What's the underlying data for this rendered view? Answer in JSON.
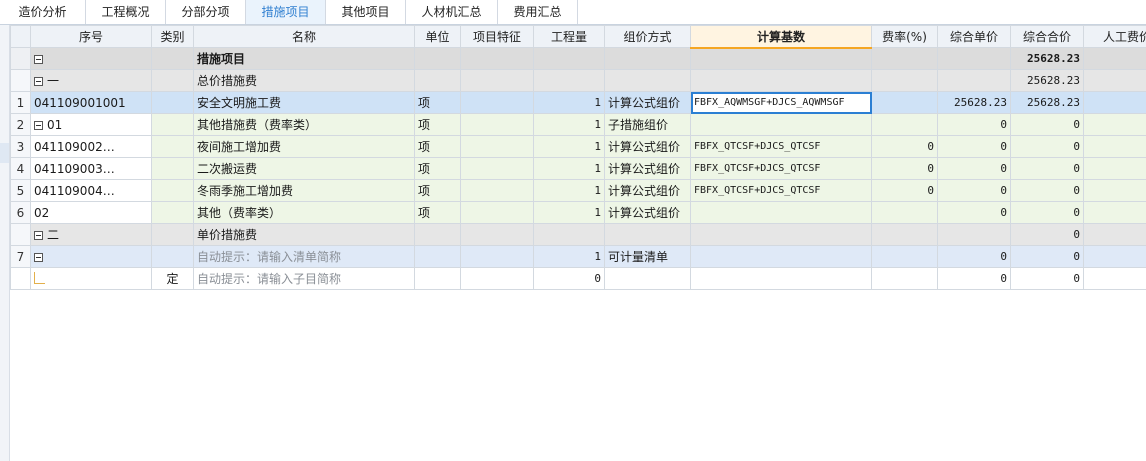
{
  "tabs": [
    "造价分析",
    "工程概况",
    "分部分项",
    "措施项目",
    "其他项目",
    "人材机汇总",
    "费用汇总"
  ],
  "active_tab": "措施项目",
  "columns": [
    "序号",
    "类别",
    "名称",
    "单位",
    "项目特征",
    "工程量",
    "组价方式",
    "计算基数",
    "费率(%)",
    "综合单价",
    "综合合价",
    "人工费价"
  ],
  "rows": [
    {
      "rn": "",
      "seq": "",
      "cat": "",
      "name": "措施项目",
      "unit": "",
      "feat": "",
      "qty": "",
      "method": "",
      "base": "",
      "rate": "",
      "uprice": "",
      "total": "25628.23"
    },
    {
      "rn": "",
      "seq": "一",
      "cat": "",
      "name": "总价措施费",
      "unit": "",
      "feat": "",
      "qty": "",
      "method": "",
      "base": "",
      "rate": "",
      "uprice": "",
      "total": "25628.23"
    },
    {
      "rn": "1",
      "seq": "041109001001",
      "cat": "",
      "name": "安全文明施工费",
      "unit": "项",
      "feat": "",
      "qty": "1",
      "method": "计算公式组价",
      "base": "FBFX_AQWMSGF+DJCS_AQWMSGF",
      "rate": "",
      "uprice": "25628.23",
      "total": "25628.23"
    },
    {
      "rn": "2",
      "seq": "01",
      "cat": "",
      "name": "其他措施费（费率类）",
      "unit": "项",
      "feat": "",
      "qty": "1",
      "method": "子措施组价",
      "base": "",
      "rate": "",
      "uprice": "0",
      "total": "0"
    },
    {
      "rn": "3",
      "seq": "041109002…",
      "cat": "",
      "name": "夜间施工增加费",
      "unit": "项",
      "feat": "",
      "qty": "1",
      "method": "计算公式组价",
      "base": "FBFX_QTCSF+DJCS_QTCSF",
      "rate": "0",
      "uprice": "0",
      "total": "0"
    },
    {
      "rn": "4",
      "seq": "041109003…",
      "cat": "",
      "name": "二次搬运费",
      "unit": "项",
      "feat": "",
      "qty": "1",
      "method": "计算公式组价",
      "base": "FBFX_QTCSF+DJCS_QTCSF",
      "rate": "0",
      "uprice": "0",
      "total": "0"
    },
    {
      "rn": "5",
      "seq": "041109004…",
      "cat": "",
      "name": "冬雨季施工增加费",
      "unit": "项",
      "feat": "",
      "qty": "1",
      "method": "计算公式组价",
      "base": "FBFX_QTCSF+DJCS_QTCSF",
      "rate": "0",
      "uprice": "0",
      "total": "0"
    },
    {
      "rn": "6",
      "seq": "02",
      "cat": "",
      "name": "其他（费率类）",
      "unit": "项",
      "feat": "",
      "qty": "1",
      "method": "计算公式组价",
      "base": "",
      "rate": "",
      "uprice": "0",
      "total": "0"
    },
    {
      "rn": "",
      "seq": "二",
      "cat": "",
      "name": "单价措施费",
      "unit": "",
      "feat": "",
      "qty": "",
      "method": "",
      "base": "",
      "rate": "",
      "uprice": "",
      "total": "0"
    },
    {
      "rn": "7",
      "seq": "",
      "cat": "",
      "name": "自动提示：请输入清单简称",
      "unit": "",
      "feat": "",
      "qty": "1",
      "method": "可计量清单",
      "base": "",
      "rate": "",
      "uprice": "0",
      "total": "0"
    },
    {
      "rn": "",
      "seq": "",
      "cat": "定",
      "name": "自动提示：请输入子目简称",
      "unit": "",
      "feat": "",
      "qty": "0",
      "method": "",
      "base": "",
      "rate": "",
      "uprice": "0",
      "total": "0"
    }
  ]
}
